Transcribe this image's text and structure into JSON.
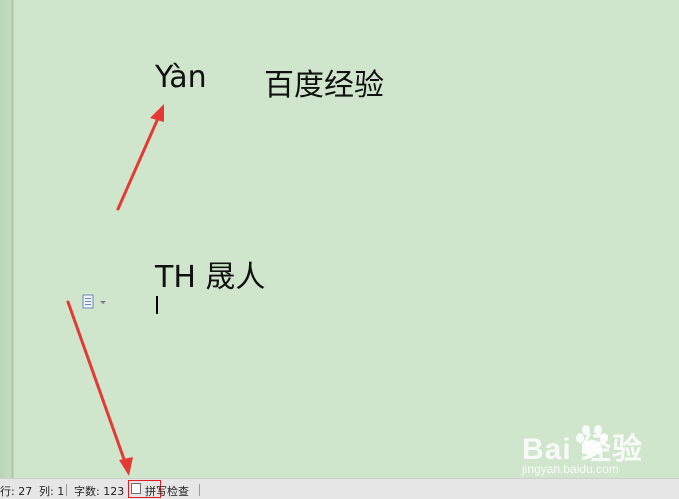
{
  "document": {
    "line1_pinyin": "Yàn",
    "line1_chinese": "百度经验",
    "line2": "TH 晟人"
  },
  "status_bar": {
    "row": "行: 27",
    "column": "列: 1",
    "word_count": "字数: 123",
    "spell_check": "拼写检查"
  },
  "watermark": {
    "brand": "Bai 经验",
    "url": "jingyan.baidu.com"
  },
  "icons": {
    "paste_options": "paste-options-icon",
    "watermark_logo": "baidu-paw-icon"
  },
  "colors": {
    "document_background": "#cfe6cc",
    "annotation_arrow": "#e53935",
    "status_bar": "#e6e6e6",
    "spell_highlight": "#e02020"
  }
}
